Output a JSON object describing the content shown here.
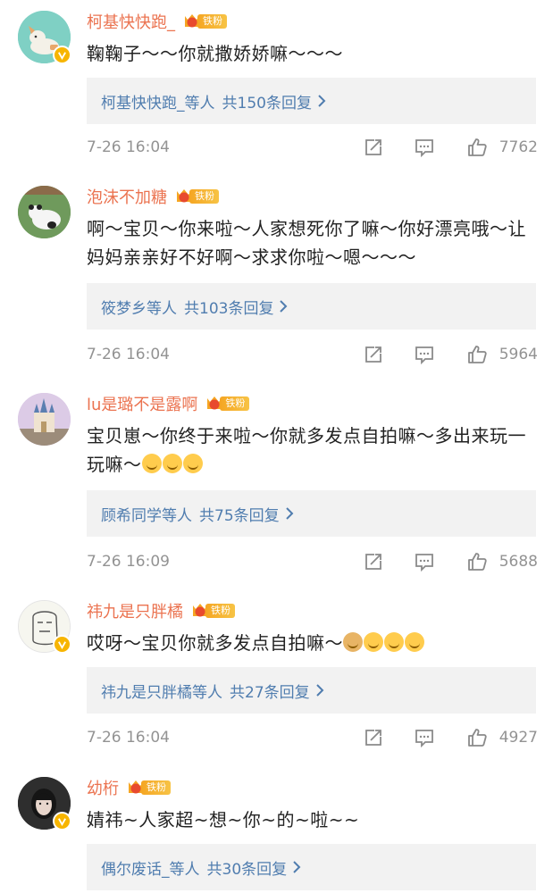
{
  "comments": [
    {
      "username": "柯基快快跑_",
      "fan_level": "5",
      "fan_label": "铁粉",
      "text": "鞠鞠子～～你就撒娇娇嘛～～～",
      "reply_users": "柯基快快跑_",
      "reply_suffix": "等人",
      "reply_count": "共150条回复",
      "time": "7-26 16:04",
      "likes": "7762",
      "avatar_icon": "corgi-icon"
    },
    {
      "username": "泡沫不加糖",
      "fan_level": "4",
      "fan_label": "铁粉",
      "text": "啊～宝贝～你来啦～人家想死你了嘛～你好漂亮哦～让妈妈亲亲好不好啊～求求你啦～嗯～～～",
      "reply_users": "筱梦乡",
      "reply_suffix": "等人",
      "reply_count": "共103条回复",
      "time": "7-26 16:04",
      "likes": "5964",
      "avatar_icon": "panda-icon"
    },
    {
      "username": "lu是璐不是露啊",
      "fan_level": "6",
      "fan_label": "铁粉",
      "text": "宝贝崽～你终于来啦～你就多发点自拍嘛～多出来玩一玩嘛～",
      "emojis": [
        "smile-emoji",
        "smile-emoji",
        "smile-emoji"
      ],
      "reply_users": "顾希同学",
      "reply_suffix": "等人",
      "reply_count": "共75条回复",
      "time": "7-26 16:09",
      "likes": "5688",
      "avatar_icon": "castle-icon"
    },
    {
      "username": "祎九是只胖橘",
      "fan_level": "4",
      "fan_label": "铁粉",
      "text": "哎呀～宝贝你就多发点自拍嘛～",
      "emojis": [
        "doge-emoji",
        "thinking-emoji",
        "smile-emoji",
        "smile-emoji"
      ],
      "reply_users": "祎九是只胖橘",
      "reply_suffix": "等人",
      "reply_count": "共27条回复",
      "time": "7-26 16:04",
      "likes": "4927",
      "avatar_icon": "sketch-face-icon"
    },
    {
      "username": "幼桁",
      "fan_level": "6",
      "fan_label": "铁粉",
      "text": "婧祎~人家超~想~你~的~啦~~",
      "reply_users": "偶尔废话_",
      "reply_suffix": "等人",
      "reply_count": "共30条回复",
      "avatar_icon": "portrait-icon"
    }
  ],
  "colors": {
    "username": "#eb7350",
    "reply_link": "#507daf",
    "meta_gray": "#939393",
    "reply_bg": "#f2f2f2",
    "verified_badge": "#f7b500"
  }
}
